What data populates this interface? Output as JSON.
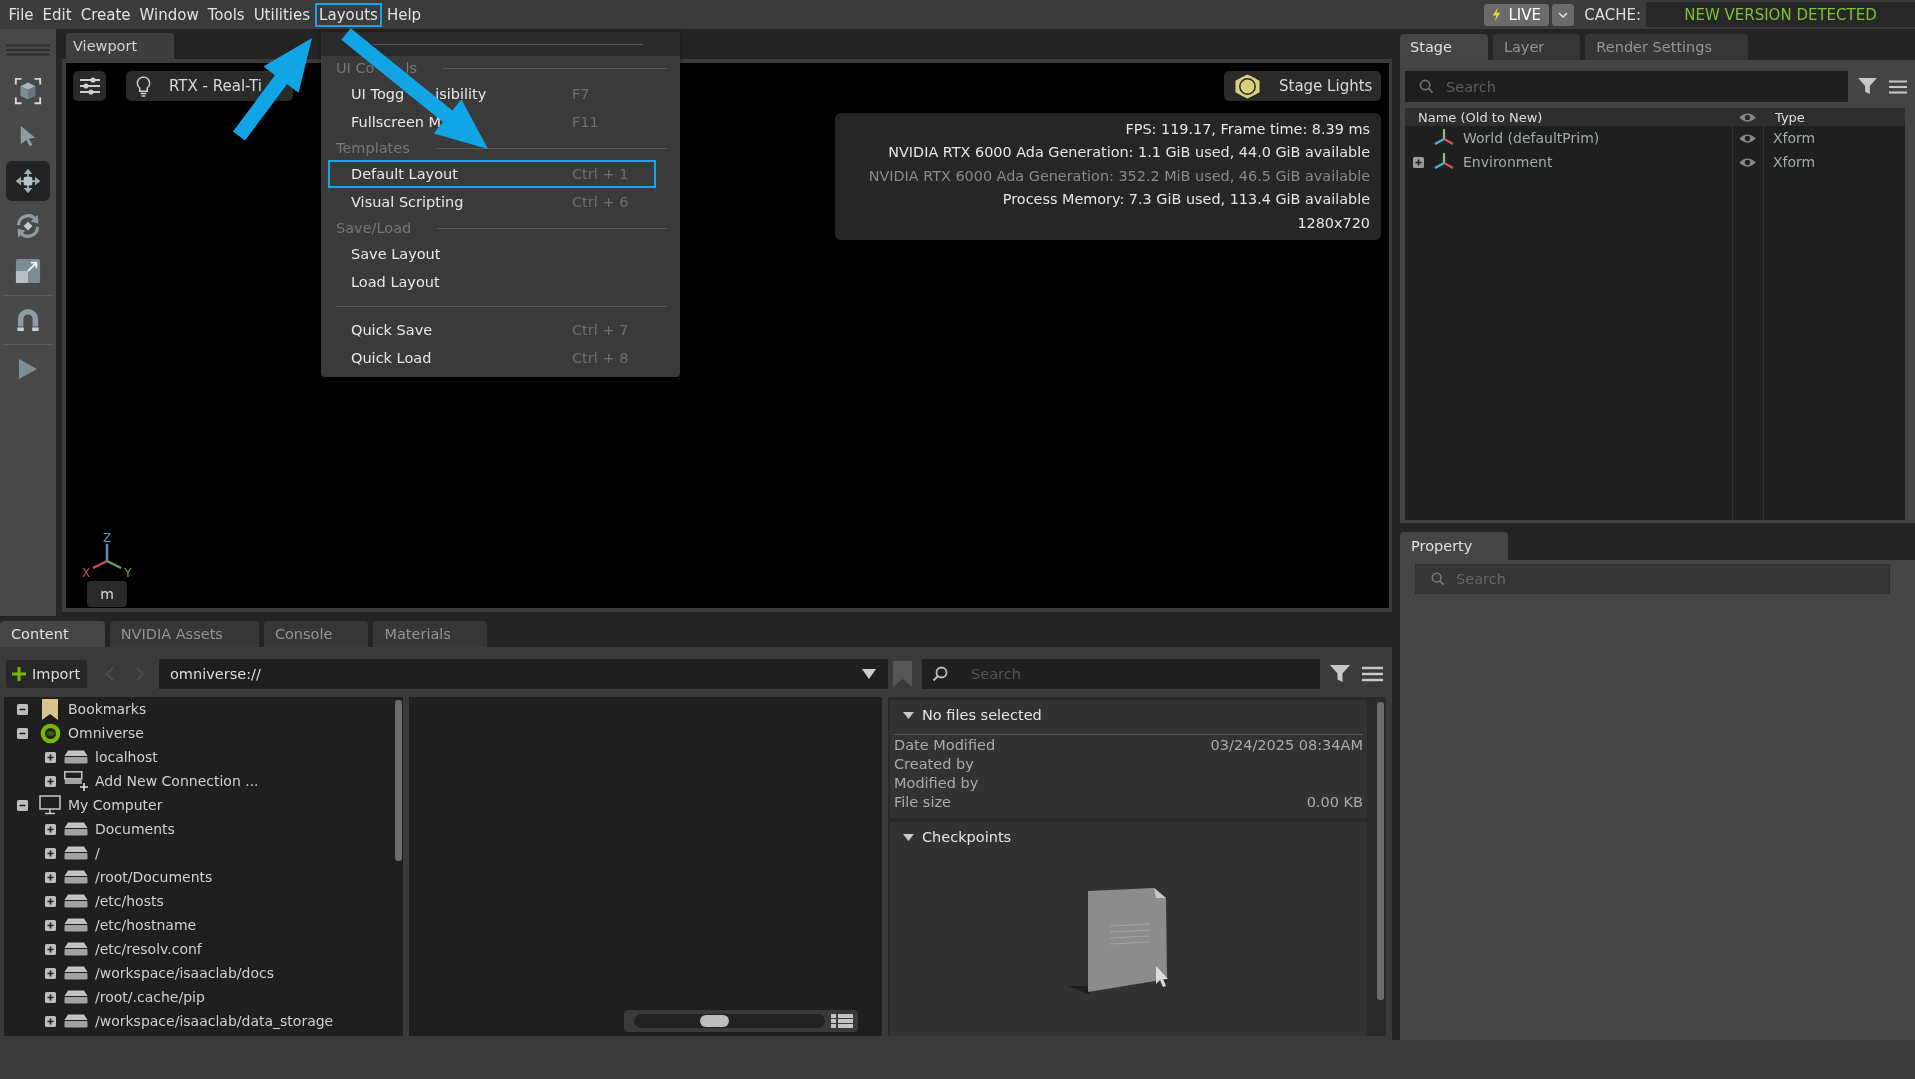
{
  "menu_bar": {
    "items": [
      {
        "label": "File",
        "highlighted": false
      },
      {
        "label": "Edit",
        "highlighted": false
      },
      {
        "label": "Create",
        "highlighted": false
      },
      {
        "label": "Window",
        "highlighted": false
      },
      {
        "label": "Tools",
        "highlighted": false
      },
      {
        "label": "Utilities",
        "highlighted": false
      },
      {
        "label": "Layouts",
        "highlighted": true
      },
      {
        "label": "Help",
        "highlighted": false
      }
    ],
    "live_button": "LIVE",
    "cache_label": "CACHE:",
    "cache_status": "NEW VERSION DETECTED"
  },
  "tool_bar": {
    "groups": [
      {
        "tools": [
          {
            "kind": "frame",
            "selected": false
          },
          {
            "kind": "select",
            "selected": false
          },
          {
            "kind": "move",
            "selected": true
          },
          {
            "kind": "rotate",
            "selected": false
          },
          {
            "kind": "scale",
            "selected": false
          }
        ]
      },
      {
        "tools": [
          {
            "kind": "snap",
            "selected": false
          }
        ]
      },
      {
        "tools": [
          {
            "kind": "play",
            "selected": false
          }
        ]
      }
    ]
  },
  "viewport": {
    "tab": {
      "label": "Viewport",
      "selected": true
    },
    "render_mode": "RTX - Real-Ti",
    "stage_lights": "Stage Lights",
    "stats": [
      {
        "text": "FPS: 119.17, Frame time: 8.39 ms",
        "dimmed": false
      },
      {
        "text": "NVIDIA RTX 6000 Ada Generation: 1.1 GiB used, 44.0 GiB available",
        "dimmed": false
      },
      {
        "text": "NVIDIA RTX 6000 Ada Generation: 352.2 MiB used, 46.5 GiB available",
        "dimmed": true
      },
      {
        "text": "Process Memory: 7.3 GiB used, 113.4 GiB available",
        "dimmed": false
      },
      {
        "text": "1280x720",
        "dimmed": false
      }
    ],
    "axis_labels": {
      "x": "X",
      "y": "Y",
      "z": "Z"
    },
    "units": "m"
  },
  "layouts_menu": {
    "entries": [
      {
        "kind": "tearoff"
      },
      {
        "kind": "header",
        "label": "UI Co",
        "label_after": "ls"
      },
      {
        "kind": "item",
        "label": "UI Togg",
        "label_after": "isibility",
        "shortcut": "F7",
        "highlighted": false
      },
      {
        "kind": "item",
        "label": "Fullscreen M",
        "shortcut": "F11",
        "highlighted": false
      },
      {
        "kind": "header",
        "label": "Templates"
      },
      {
        "kind": "item",
        "label": "Default Layout",
        "shortcut": "Ctrl + 1",
        "highlighted": true
      },
      {
        "kind": "item",
        "label": "Visual Scripting",
        "shortcut": "Ctrl + 6",
        "highlighted": false
      },
      {
        "kind": "header",
        "label": "Save/Load"
      },
      {
        "kind": "item",
        "label": "Save Layout",
        "highlighted": false
      },
      {
        "kind": "item",
        "label": "Load Layout",
        "highlighted": false
      },
      {
        "kind": "separator"
      },
      {
        "kind": "item",
        "label": "Quick Save",
        "shortcut": "Ctrl + 7",
        "highlighted": false
      },
      {
        "kind": "item",
        "label": "Quick Load",
        "shortcut": "Ctrl + 8",
        "highlighted": false
      }
    ]
  },
  "stage_panel": {
    "tabs": [
      {
        "label": "Stage",
        "selected": true
      },
      {
        "label": "Layer",
        "selected": false
      },
      {
        "label": "Render Settings",
        "selected": false
      }
    ],
    "search": {
      "placeholder": "Search"
    },
    "columns": {
      "name": "Name (Old to New)",
      "type": "Type"
    },
    "prims": [
      {
        "name": "World (defaultPrim)",
        "type": "Xform",
        "expandable": false
      },
      {
        "name": "Environment",
        "type": "Xform",
        "expandable": true
      }
    ]
  },
  "property_panel": {
    "tab": {
      "label": "Property",
      "selected": true
    },
    "search": {
      "placeholder": "Search"
    }
  },
  "content_panel": {
    "tabs": [
      {
        "label": "Content",
        "selected": true
      },
      {
        "label": "NVIDIA Assets",
        "selected": false
      },
      {
        "label": "Console",
        "selected": false
      },
      {
        "label": "Materials",
        "selected": false
      }
    ],
    "import_button": "Import",
    "path": "omniverse://",
    "search": {
      "placeholder": "Search"
    },
    "tree": [
      {
        "label": "Bookmarks",
        "kind": "bookmarks",
        "expanded": true
      },
      {
        "label": "Omniverse",
        "kind": "omniverse",
        "expanded": true,
        "children": [
          {
            "label": "localhost",
            "kind": "drive",
            "expanded": false
          },
          {
            "label": "Add New Connection ...",
            "kind": "add_connection",
            "expanded": false
          }
        ]
      },
      {
        "label": "My Computer",
        "kind": "computer",
        "expanded": true,
        "children": [
          {
            "label": "Documents",
            "kind": "drive",
            "expanded": false
          },
          {
            "label": "/",
            "kind": "drive",
            "expanded": false
          },
          {
            "label": "/root/Documents",
            "kind": "drive",
            "expanded": false
          },
          {
            "label": "/etc/hosts",
            "kind": "drive",
            "expanded": false
          },
          {
            "label": "/etc/hostname",
            "kind": "drive",
            "expanded": false
          },
          {
            "label": "/etc/resolv.conf",
            "kind": "drive",
            "expanded": false
          },
          {
            "label": "/workspace/isaaclab/docs",
            "kind": "drive",
            "expanded": false
          },
          {
            "label": "/root/.cache/pip",
            "kind": "drive",
            "expanded": false
          },
          {
            "label": "/workspace/isaaclab/data_storage",
            "kind": "drive",
            "expanded": false
          }
        ]
      }
    ],
    "thumbnail_size": {
      "level": 0.41
    },
    "details": {
      "title": "No files selected",
      "expanded": true,
      "fields": [
        {
          "label": "Date Modified",
          "value": "03/24/2025 08:34AM"
        },
        {
          "label": "Created by"
        },
        {
          "label": "Modified by"
        },
        {
          "label": "File size",
          "value": "0.00 KB"
        }
      ]
    },
    "checkpoints": {
      "title": "Checkpoints",
      "expanded": true
    }
  }
}
